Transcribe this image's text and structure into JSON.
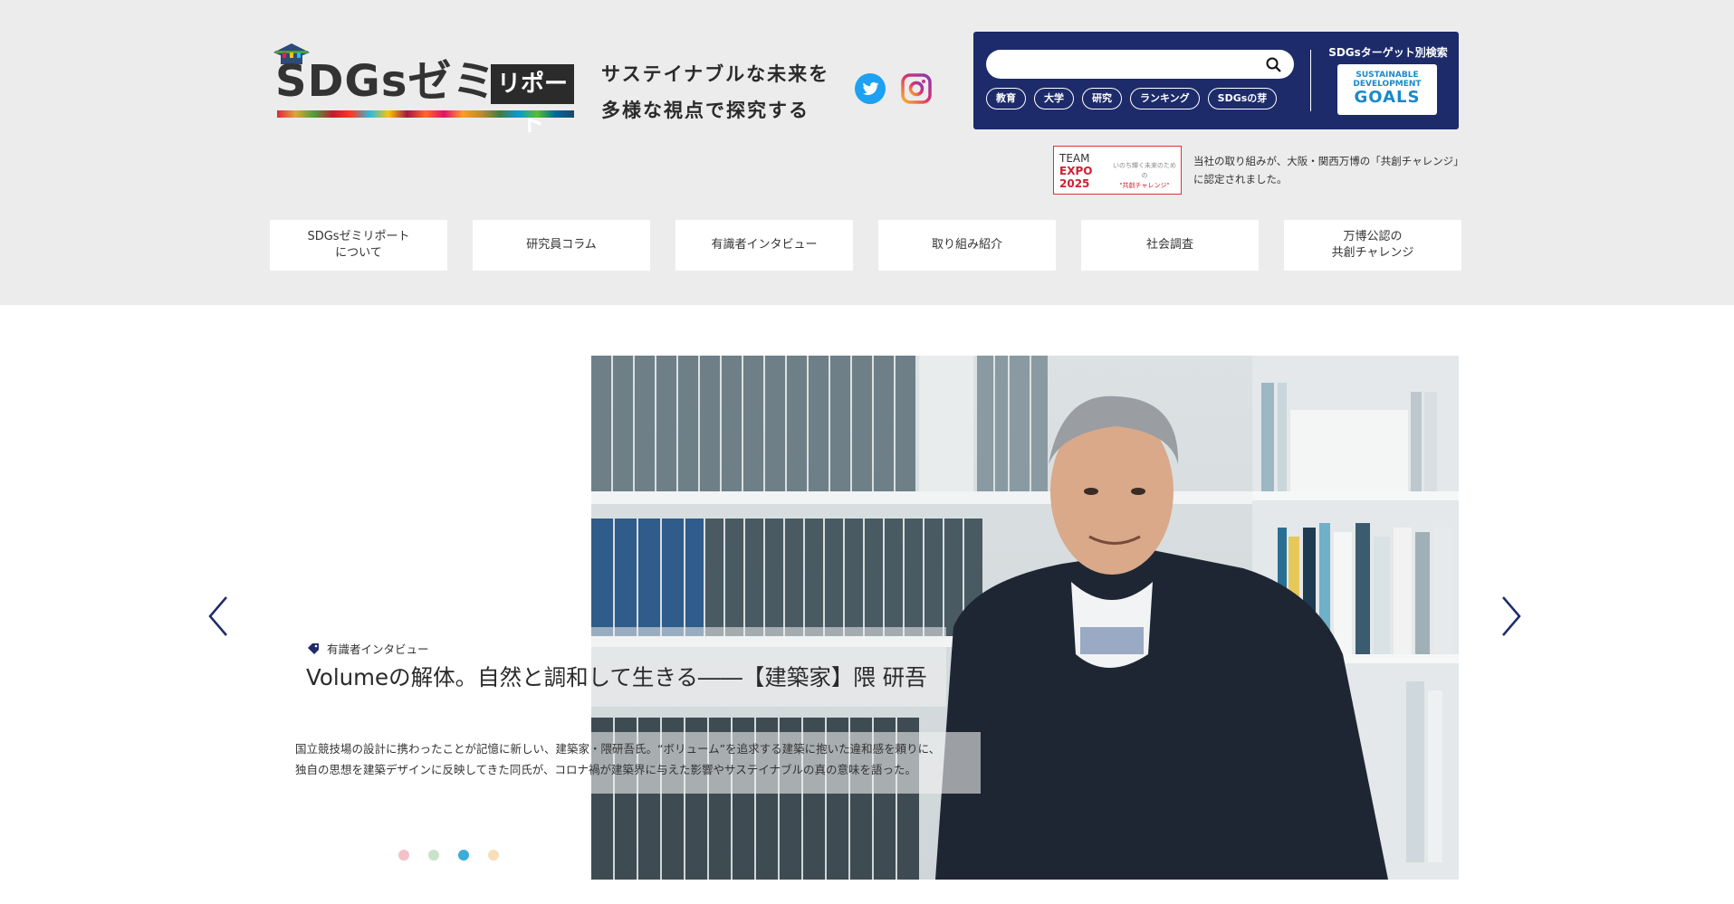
{
  "header": {
    "logo_text": "SDGsゼミ",
    "logo_box": "リポート",
    "tagline_line1": "サステイナブルな未来を",
    "tagline_line2": "多様な視点で探究する"
  },
  "social": {
    "twitter_icon": "twitter-bird-icon",
    "instagram_icon": "instagram-camera-icon"
  },
  "search": {
    "placeholder": "",
    "tags": [
      "教育",
      "大学",
      "研究",
      "ランキング",
      "SDGsの芽"
    ],
    "sdg_search_label": "SDGsターゲット別検索",
    "sdg_logo_line1": "SUSTAINABLE",
    "sdg_logo_line2": "DEVELOPMENT",
    "sdg_logo_line3": "GOALS"
  },
  "expo": {
    "team": "TEAM",
    "expo": "EXPO",
    "year": "2025",
    "sub1": "いのち輝く未来のための",
    "sub2": "\"共創チャレンジ\"",
    "text": "当社の取り組みが、大阪・関西万博の「共創チャレンジ」に認定されました。"
  },
  "nav": {
    "items": [
      "SDGsゼミリポート\nについて",
      "研究員コラム",
      "有識者インタビュー",
      "取り組み紹介",
      "社会調査",
      "万博公認の\n共創チャレンジ"
    ]
  },
  "hero": {
    "category": "有識者インタビュー",
    "title": "Volumeの解体。自然と調和して生きる――【建築家】隈 研吾",
    "desc_line1": "国立競技場の設計に携わったことが記憶に新しい、建築家・隈研吾氏。“ボリューム”を追求する建築に抱いた違和感を頼りに、",
    "desc_line2": "独自の思想を建築デザインに反映してきた同氏が、コロナ禍が建築界に与えた影響やサステイナブルの真の意味を語った。",
    "dot_colors": [
      "#f3c2c9",
      "#c9e3c9",
      "#3aaed8",
      "#f7dfba"
    ],
    "active_dot": 3
  },
  "colors": {
    "header_bg": "#ececec",
    "search_panel": "#1d2b6b",
    "accent_blue": "#1a89c8"
  }
}
